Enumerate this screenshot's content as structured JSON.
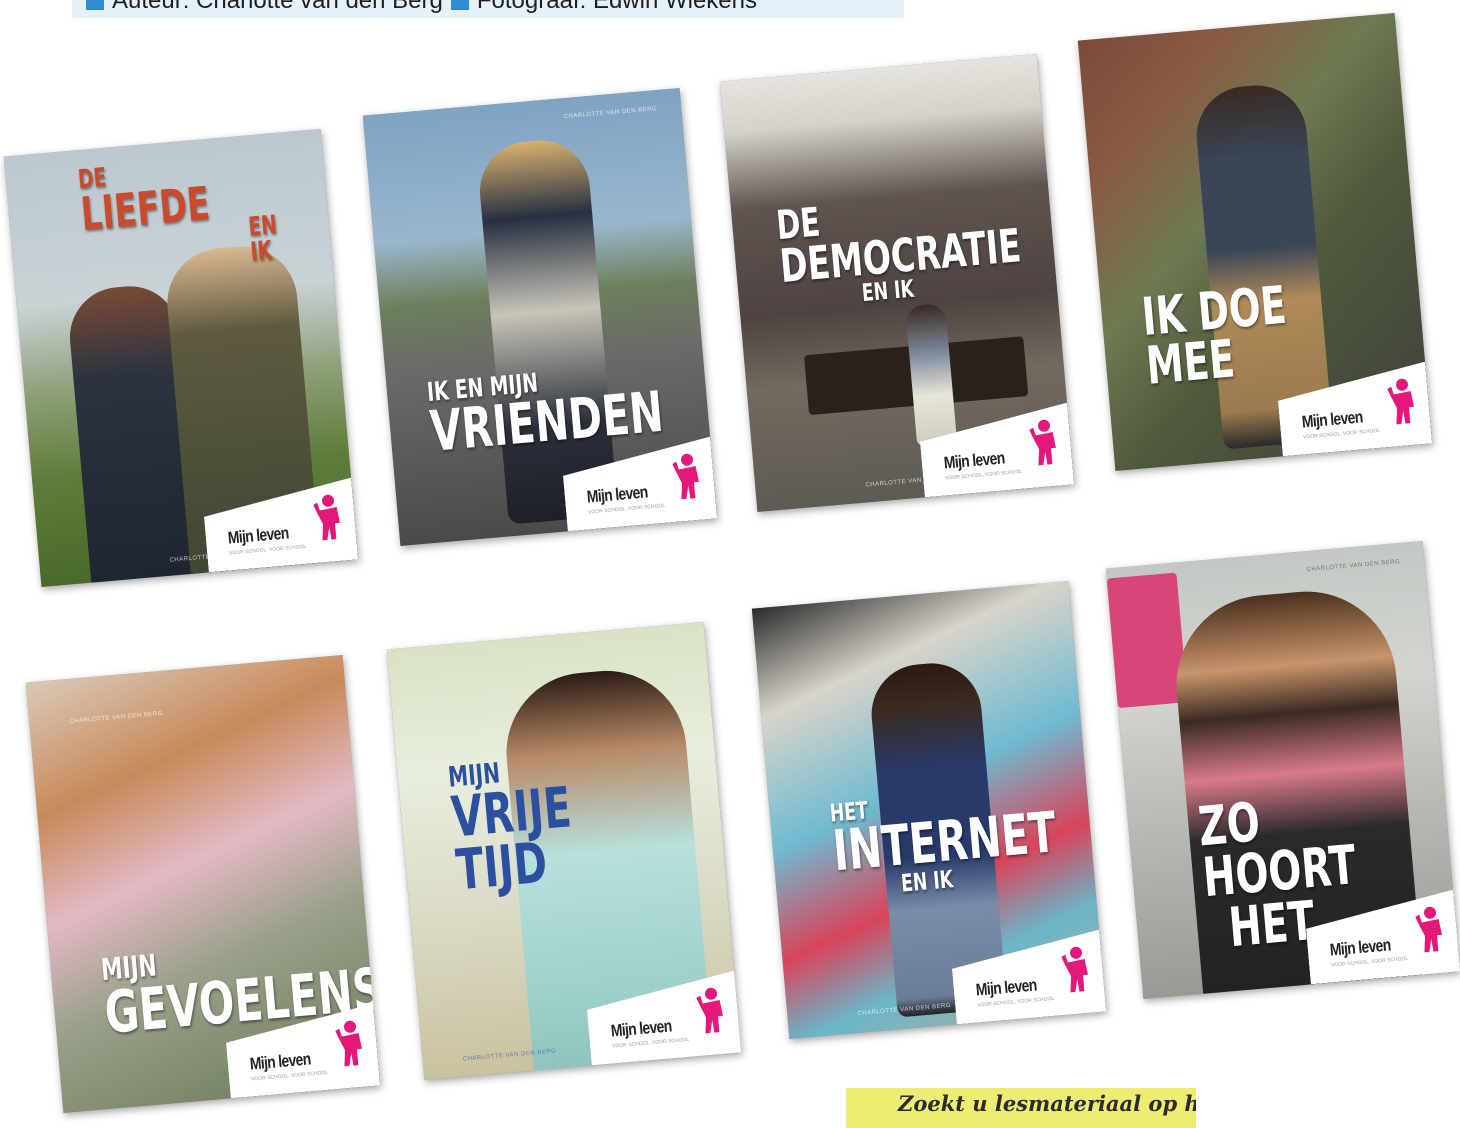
{
  "credit": {
    "author": "Auteur: Charlotte van den Berg",
    "photographer": "Fotograaf: Edwin Wiekens"
  },
  "brand": {
    "logo_text": "Mijn leven",
    "logo_subtext": "VOOR SCHOOL, VOOR SCHOOL",
    "accent_color": "#e4177a"
  },
  "covers": [
    {
      "title_lines": [
        "DE",
        "LIEFDE",
        "EN IK"
      ],
      "small_print": "CHARLOTTE VAN DEN BERG"
    },
    {
      "title_lines": [
        "IK EN MIJN",
        "VRIENDEN"
      ],
      "small_print": "CHARLOTTE VAN DEN BERG"
    },
    {
      "title_lines": [
        "DE",
        "DEMOCRATIE",
        "EN IK"
      ],
      "small_print": "CHARLOTTE VAN DEN BERG"
    },
    {
      "title_lines": [
        "IK DOE MEE"
      ],
      "small_print": ""
    },
    {
      "title_lines": [
        "MIJN",
        "GEVOELENS"
      ],
      "small_print": "CHARLOTTE VAN DEN BERG"
    },
    {
      "title_lines": [
        "MIJN",
        "VRIJE",
        "TIJD"
      ],
      "small_print": "CHARLOTTE VAN DEN BERG"
    },
    {
      "title_lines": [
        "HET",
        "INTERNET",
        "EN IK"
      ],
      "small_print": "CHARLOTTE VAN DEN BERG"
    },
    {
      "title_lines": [
        "ZO",
        "HOORT",
        "HET"
      ],
      "small_print": "CHARLOTTE VAN DEN BERG"
    }
  ],
  "note": {
    "text": "Zoekt u lesmateriaal op het gebied van"
  }
}
